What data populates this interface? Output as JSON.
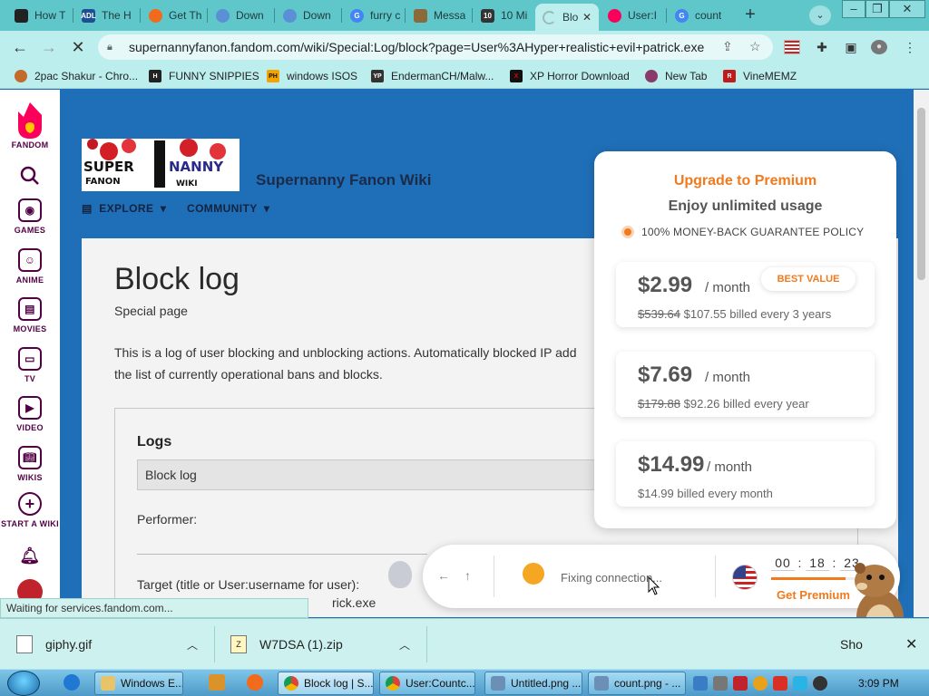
{
  "browser": {
    "tabs": [
      {
        "title": "How T",
        "icon": "dark-app-icon",
        "color": "#222222"
      },
      {
        "title": "The H",
        "icon": "adl-icon",
        "color": "#1d4f91"
      },
      {
        "title": "Get Th",
        "icon": "fire-icon",
        "color": "#f26a1b"
      },
      {
        "title": "Down",
        "icon": "gear-icon",
        "color": "#5b8fd6"
      },
      {
        "title": "Down",
        "icon": "gear-icon",
        "color": "#5b8fd6"
      },
      {
        "title": "furry c",
        "icon": "google-icon",
        "color": "#4285f4"
      },
      {
        "title": "Messa",
        "icon": "image-icon",
        "color": "#8a6a3a"
      },
      {
        "title": "10 Mi",
        "icon": "ten-icon",
        "color": "#333333"
      },
      {
        "title": "Blo",
        "icon": "loading-icon",
        "color": "#9bbbbb",
        "active": true
      },
      {
        "title": "User:I",
        "icon": "fandom-icon",
        "color": "#fa005a"
      },
      {
        "title": "count",
        "icon": "google-icon",
        "color": "#4285f4"
      }
    ],
    "url": "supernannyfanon.fandom.com/wiki/Special:Log/block?page=User%3AHyper+realistic+evil+patrick.exe",
    "bookmarks": [
      {
        "label": "2pac Shakur - Chro...",
        "icon": "music-icon",
        "color": "#c46a2a"
      },
      {
        "label": "FUNNY SNIPPIES",
        "icon": "h-icon",
        "color": "#222222"
      },
      {
        "label": "windows ISOS",
        "icon": "ph-icon",
        "color": "#f5a300"
      },
      {
        "label": "EndermanCH/Malw...",
        "icon": "yp-icon",
        "color": "#333333"
      },
      {
        "label": "XP Horror Download",
        "icon": "x-icon",
        "color": "#111111"
      },
      {
        "label": "New Tab",
        "icon": "globe-icon",
        "color": "#8a3a6a"
      },
      {
        "label": "VineMEMZ",
        "icon": "r-icon",
        "color": "#c01a1a"
      }
    ]
  },
  "rail": {
    "brand": "FANDOM",
    "items": [
      {
        "label": "GAMES"
      },
      {
        "label": "ANIME"
      },
      {
        "label": "MOVIES"
      },
      {
        "label": "TV"
      },
      {
        "label": "VIDEO"
      },
      {
        "label": "WIKIS"
      },
      {
        "label": "START A WIKI"
      }
    ]
  },
  "wiki": {
    "logo": {
      "top": "SUPER",
      "bottom": "NANNY",
      "fanon": "FANON",
      "wiki": "WIKI"
    },
    "name": "Supernanny Fanon Wiki",
    "nav": {
      "explore": "EXPLORE",
      "community": "COMMUNITY"
    }
  },
  "article": {
    "title": "Block log",
    "subtitle": "Special page",
    "intro_line1": "This is a log of user blocking and unblocking actions. Automatically blocked IP add",
    "intro_line2": "the list of currently operational bans and blocks.",
    "logs_heading": "Logs",
    "log_type": "Block log",
    "performer_label": "Performer:",
    "target_label": "Target (title or User:username for user):",
    "target_value": "rick.exe"
  },
  "premium": {
    "title": "Upgrade to Premium",
    "subtitle": "Enjoy unlimited usage",
    "guarantee": "100% MONEY-BACK GUARANTEE POLICY",
    "plans": [
      {
        "price": "$2.99",
        "per": "/ month",
        "old": "$539.64",
        "billed": "$107.55 billed every 3 years",
        "badge": "BEST VALUE"
      },
      {
        "price": "$7.69",
        "per": "/ month",
        "old": "$179.88",
        "billed": "$92.26 billed every year"
      },
      {
        "price": "$14.99",
        "per": "/ month",
        "old": "",
        "billed": "$14.99 billed every month"
      }
    ]
  },
  "vpn": {
    "status": "Fixing connection...",
    "timer": {
      "h": "00",
      "m": "18",
      "s": "23"
    },
    "progress_percent": 85,
    "cta": "Get Premium"
  },
  "status_bar": "Waiting for services.fandom.com...",
  "downloads": [
    {
      "name": "giphy.gif"
    },
    {
      "name": "W7DSA (1).zip"
    }
  ],
  "downloads_show_all": "Sho",
  "taskbar": {
    "buttons": [
      {
        "label": "Windows E..."
      },
      {
        "label": "Block log | S..."
      },
      {
        "label": "User:Countc..."
      },
      {
        "label": "Untitled.png ..."
      },
      {
        "label": "count.png - ..."
      }
    ],
    "clock": "3:09 PM"
  }
}
